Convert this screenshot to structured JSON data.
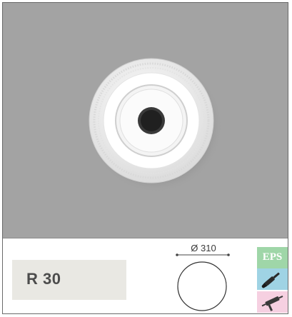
{
  "product": {
    "name": "R 30",
    "diameter_label": "Ø 310"
  },
  "materials": {
    "eps_label": "EPS",
    "paint_icon": "paintbrush-icon",
    "glue_icon": "glue-gun-icon"
  },
  "colors": {
    "photo_background": "#a3a3a3",
    "name_badge": "#e9e8e3",
    "eps_badge": "#9fd6a8",
    "paint_badge": "#9fd3e4",
    "glue_badge": "#f6d0e1"
  }
}
